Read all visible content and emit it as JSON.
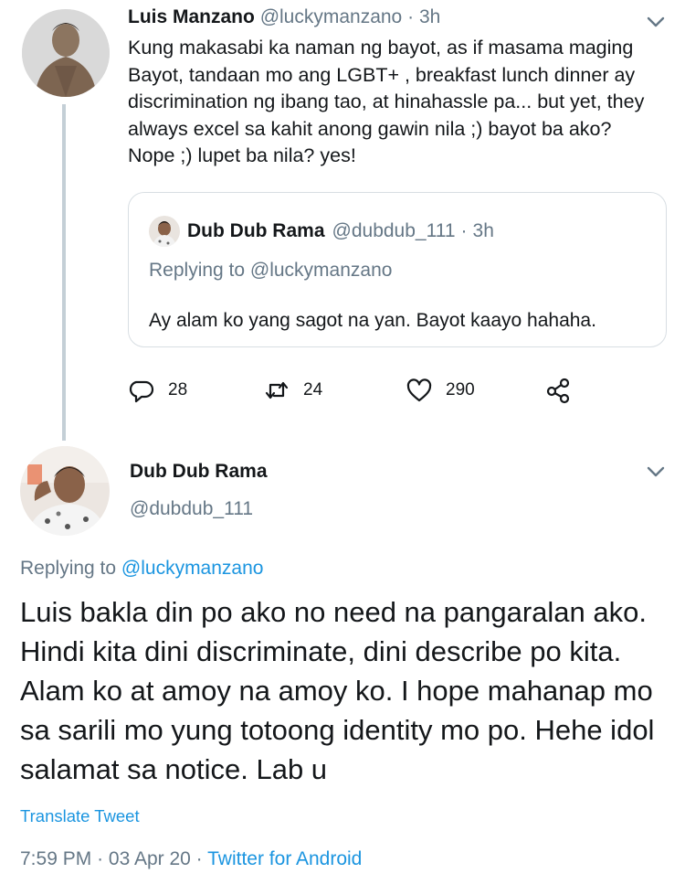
{
  "tweet1": {
    "author_name": "Luis Manzano",
    "author_handle": "@luckymanzano",
    "dot": "·",
    "time": "3h",
    "body": "Kung makasabi ka naman ng bayot, as if masama maging Bayot, tandaan mo ang LGBT+ , breakfast lunch dinner ay discrimination ng ibang tao, at hinahassle pa... but yet, they always excel sa kahit anong gawin nila ;) bayot ba ako? Nope ;) lupet ba nila? yes!",
    "quoted": {
      "author_name": "Dub Dub Rama",
      "author_handle": "@dubdub_111",
      "dot": "·",
      "time": "3h",
      "replying_to": "Replying to @luckymanzano",
      "text": "Ay alam ko yang sagot na yan. Bayot kaayo hahaha."
    },
    "actions": {
      "replies": "28",
      "retweets": "24",
      "likes": "290"
    }
  },
  "tweet2": {
    "author_name": "Dub Dub Rama",
    "author_handle": "@dubdub_111",
    "replying_prefix": "Replying to",
    "replying_handle": "@luckymanzano",
    "body": "Luis bakla din po ako no need na pangaralan ako. Hindi kita dini discriminate, dini describe po kita. Alam ko at amoy na amoy ko. I hope mahanap mo sa sarili mo yung totoong identity mo po. Hehe idol salamat sa notice. Lab u",
    "translate_label": "Translate Tweet",
    "time": "7:59 PM",
    "date": "03 Apr 20",
    "dot": "·",
    "source": "Twitter for Android"
  },
  "colors": {
    "link": "#1b95e0",
    "muted": "#657786",
    "text": "#14171a",
    "thread_line": "#c4cfd6"
  },
  "icons": [
    "chevron-down-icon",
    "reply-icon",
    "retweet-icon",
    "like-icon",
    "share-icon"
  ]
}
